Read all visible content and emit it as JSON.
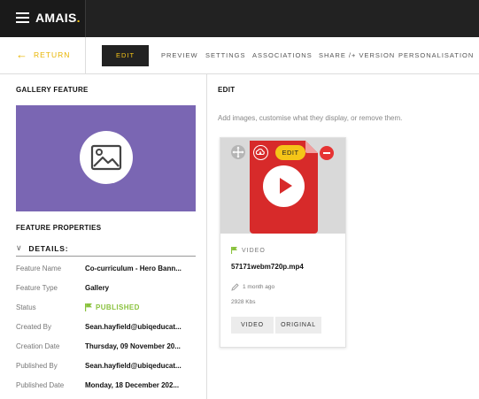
{
  "app": {
    "logo_text": "AMAIS",
    "logo_dot": "."
  },
  "nav": {
    "return_label": "RETURN",
    "tabs": [
      {
        "label": "EDIT",
        "active": true
      },
      {
        "label": "PREVIEW",
        "active": false
      },
      {
        "label": "SETTINGS",
        "active": false
      },
      {
        "label": "ASSOCIATIONS",
        "active": false
      },
      {
        "label": "SHARE /+ VERSION",
        "active": false
      },
      {
        "label": "PERSONALISATION",
        "active": false
      }
    ]
  },
  "left": {
    "title": "GALLERY FEATURE",
    "properties_title": "FEATURE PROPERTIES",
    "details_label": "DETAILS:",
    "properties": [
      {
        "key": "Feature Name",
        "value": "Co-curriculum - Hero Bann..."
      },
      {
        "key": "Feature Type",
        "value": "Gallery"
      },
      {
        "key": "Status",
        "value": "PUBLISHED"
      },
      {
        "key": "Created By",
        "value": "Sean.hayfield@ubiqeducat..."
      },
      {
        "key": "Creation Date",
        "value": "Thursday, 09 November 20..."
      },
      {
        "key": "Published By",
        "value": "Sean.hayfield@ubiqeducat..."
      },
      {
        "key": "Published Date",
        "value": "Monday, 18 December 202..."
      }
    ]
  },
  "right": {
    "title": "EDIT",
    "hint": "Add images, customise what they display, or remove them.",
    "card": {
      "edit_label": "EDIT",
      "type_label": "VIDEO",
      "filename": "57171webm720p.mp4",
      "modified": "1 month ago",
      "size": "2928 Kbs",
      "buttons": [
        "VIDEO",
        "ORIGINAL"
      ]
    }
  },
  "colors": {
    "accent": "#f5c518",
    "topbar": "#222222",
    "banner": "#7a66b3",
    "published": "#8ac23e",
    "video_red": "#d72a2a"
  },
  "icons": [
    "hamburger-icon",
    "arrow-left-icon",
    "image-icon",
    "chevron-down-icon",
    "flag-icon",
    "move-icon",
    "cloud-icon",
    "minus-icon",
    "play-icon",
    "pencil-icon"
  ]
}
